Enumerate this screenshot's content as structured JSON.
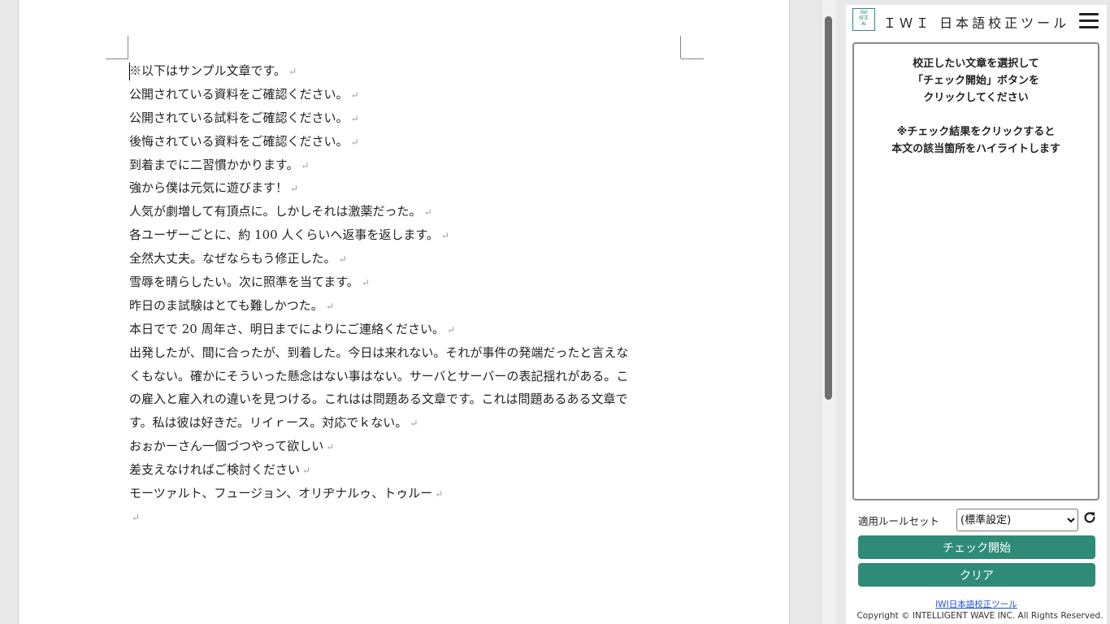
{
  "document": {
    "lines": [
      "※以下はサンプル文章です。",
      "公開されている資料をご確認ください。",
      "公開されている試料をご確認ください。",
      "後悔されている資料をご確認ください。",
      "到着までに二習慣かかります。",
      "強から僕は元気に遊びます！",
      "人気が劇増して有頂点に。しかしそれは激薬だった。",
      "各ユーザーごとに、約 100 人くらいへ返事を返します。",
      "全然大丈夫。なぜならもう修正した。",
      "雪辱を晴らしたい。次に照準を当てます。",
      "昨日のま試験はとても難しかつた。",
      "本日でで 20 周年さ、明日までによりにご連絡ください。",
      "出発したが、間に合ったが、到着した。今日は来れない。それが事件の発端だったと言えな",
      "くもない。確かにそういった懸念はない事はない。サーバとサーバーの表記揺れがある。こ",
      "の雇入と雇入れの違いを見つける。これはは問題ある文章です。これは問題あるある文章で",
      "す。私は彼は好きだ。リイｒース。対応でｋない。",
      "おぉかーさん一個づつやって欲しい",
      "差支えなければご検討ください",
      "モーツァルト、フュージョン、オリヂナルゥ、トゥルー",
      ""
    ],
    "line_end_marks": [
      true,
      true,
      true,
      true,
      true,
      true,
      true,
      true,
      true,
      true,
      true,
      true,
      false,
      false,
      false,
      true,
      true,
      true,
      true,
      true
    ],
    "return_mark": "↵"
  },
  "panel": {
    "logo_text": [
      "IWI",
      "校正",
      "AI"
    ],
    "title": "ＩＷＩ 日本語校正ツール",
    "instructions_1": [
      "校正したい文章を選択して",
      "「チェック開始」ボタンを",
      "クリックしてください"
    ],
    "instructions_2": [
      "※チェック結果をクリックすると",
      "本文の該当箇所をハイライトします"
    ],
    "ruleset_label": "適用ルールセット",
    "ruleset_selected": "(標準設定)",
    "check_start_label": "チェック開始",
    "clear_label": "クリア",
    "footer_link": "IWI日本語校正ツール",
    "copyright": "Copyright © INTELLIGENT WAVE INC. All Rights Reserved.",
    "accent_color": "#2e8b77"
  }
}
